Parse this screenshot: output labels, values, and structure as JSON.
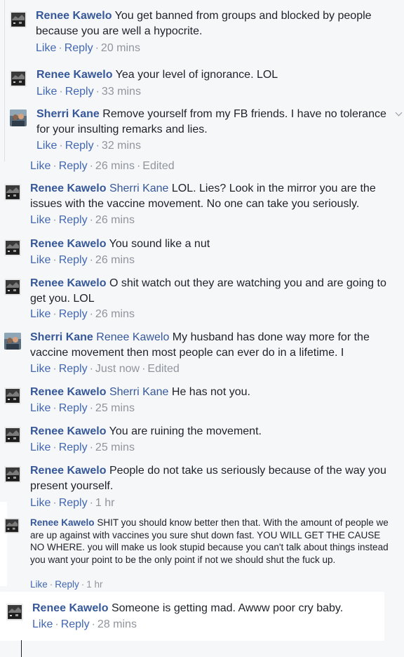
{
  "comments": [
    {
      "id": 1,
      "author": "Renee Kawelo",
      "text": "You get banned from groups and blocked by people because you are well a hypocrite.",
      "actions": {
        "like": "Like",
        "reply": "Reply",
        "time": "20 mins"
      }
    },
    {
      "id": 2,
      "author": "Renee Kawelo",
      "text": "Yea your level of ignorance. LOL",
      "actions": {
        "like": "Like",
        "reply": "Reply",
        "time": "33 mins"
      }
    },
    {
      "id": 3,
      "author": "Sherri Kane",
      "text": "Remove yourself from my FB friends. I have no tolerance for your insulting remarks and lies.",
      "actions": {
        "like": "Like",
        "reply": "Reply",
        "time": "32 mins"
      }
    },
    {
      "id": 4,
      "actions": {
        "like": "Like",
        "reply": "Reply",
        "time": "26 mins",
        "edited": "Edited"
      }
    },
    {
      "id": 5,
      "author": "Renee Kawelo",
      "tag": "Sherri Kane",
      "text": "LOL. Lies? Look in the mirror you are the issues with the vaccine movement. No one can take you seriously.",
      "actions": {
        "like": "Like",
        "reply": "Reply",
        "time": "26 mins"
      }
    },
    {
      "id": 6,
      "author": "Renee Kawelo",
      "text": "You sound like a nut",
      "actions": {
        "like": "Like",
        "reply": "Reply",
        "time": "26 mins"
      }
    },
    {
      "id": 7,
      "author": "Renee Kawelo",
      "text": "O shit watch out they are watching you and are going to get you. LOL",
      "actions": {
        "like": "Like",
        "reply": "Reply",
        "time": "26 mins"
      }
    },
    {
      "id": 8,
      "author": "Sherri Kane",
      "tag": "Renee Kawelo",
      "text": "My husband has done way more for the vaccine movement then most people can ever do in a lifetime. I",
      "actions": {
        "like": "Like",
        "reply": "Reply",
        "time": "Just now",
        "edited": "Edited"
      }
    },
    {
      "id": 9,
      "author": "Renee Kawelo",
      "tag": "Sherri Kane",
      "text": "He has not you.",
      "actions": {
        "like": "Like",
        "reply": "Reply",
        "time": "25 mins"
      }
    },
    {
      "id": 10,
      "author": "Renee Kawelo",
      "text": "You are ruining the movement.",
      "actions": {
        "like": "Like",
        "reply": "Reply",
        "time": "25 mins"
      }
    },
    {
      "id": 11,
      "author": "Renee Kawelo",
      "text": "People do not take us seriously because of the way you present yourself.",
      "actions": {
        "like": "Like",
        "reply": "Reply",
        "time": "1 hr"
      }
    },
    {
      "id": 12,
      "author": "Renee Kawelo",
      "text": "SHIT you should know better then that. With the amount of people we are up against with vaccines you sure shut down fast. YOU WILL GET THE CAUSE NO WHERE. you will make us look stupid because you can't talk about things instead you want your point to be the only point if not we should shut the fuck up.",
      "actions": {
        "like": "Like",
        "reply": "Reply",
        "time": "1 hr"
      }
    },
    {
      "id": 13,
      "author": "Renee Kawelo",
      "text": "Someone is getting mad. Awww poor cry baby.",
      "actions": {
        "like": "Like",
        "reply": "Reply",
        "time": "28 mins"
      }
    }
  ],
  "separator": "·",
  "colors": {
    "link": "#4267b2",
    "name": "#365899",
    "meta": "#90949c",
    "background": "#f6f7f9"
  },
  "icons": {
    "renee_avatar": "dark-photo-avatar",
    "sherri_avatar": "couple-photo-avatar"
  }
}
